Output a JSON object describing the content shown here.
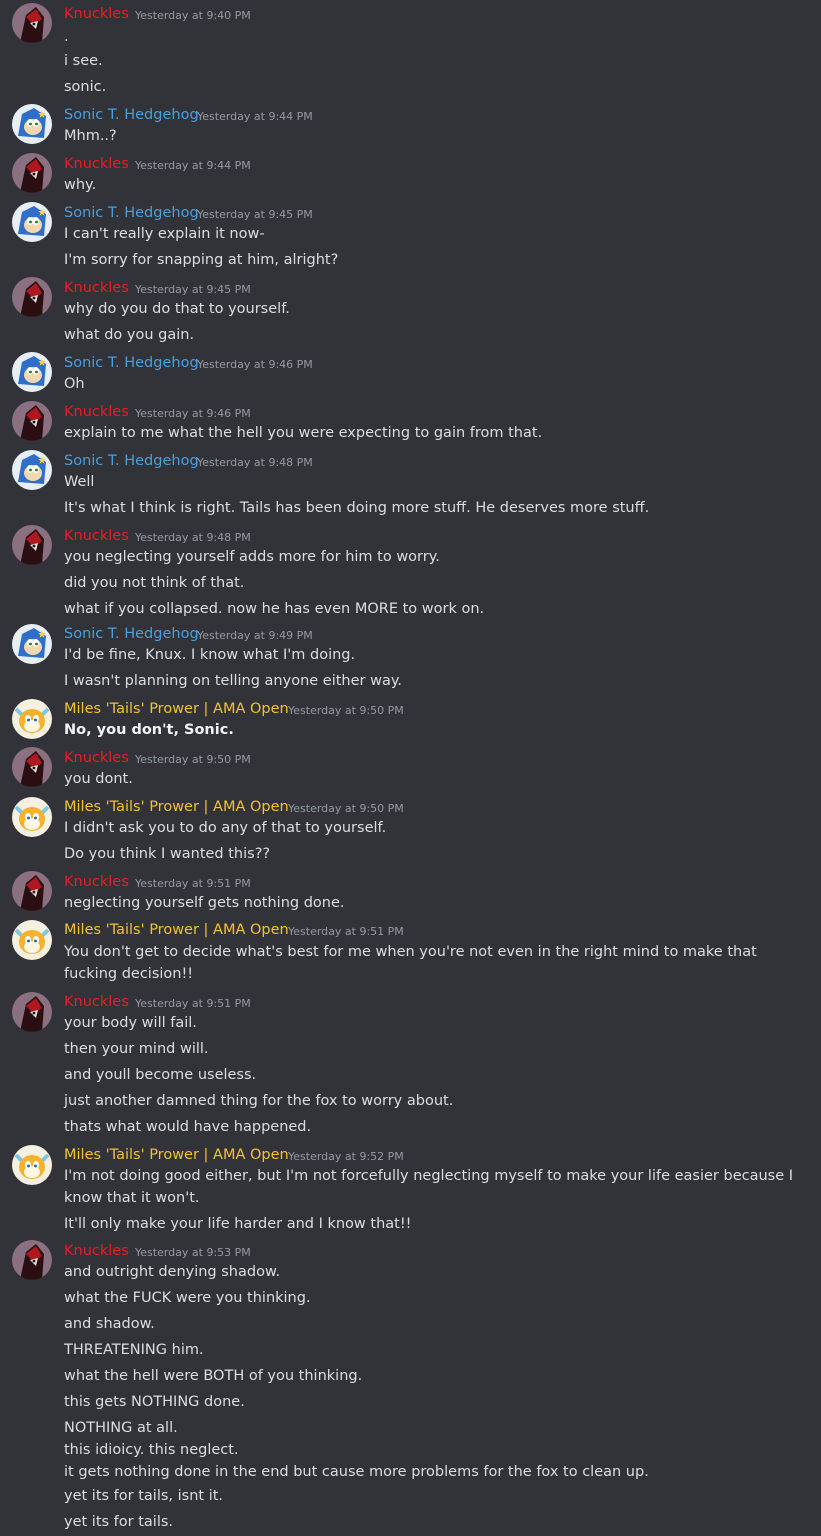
{
  "users": {
    "knuckles": {
      "name": "Knuckles",
      "color": "#ed1c24"
    },
    "sonic": {
      "name": "Sonic T. Hedgehog",
      "color": "#4a9fdf"
    },
    "tails": {
      "name": "Miles 'Tails' Prower | AMA Open",
      "color": "#f2c230"
    }
  },
  "messages": [
    {
      "user": "Knuckles",
      "time": "Yesterday at 9:40 PM",
      "lines": [
        ".",
        "i see.",
        "sonic."
      ]
    },
    {
      "user": "Sonic T. Hedgehog",
      "time": "Yesterday at 9:44 PM",
      "lines": [
        "Mhm..?"
      ]
    },
    {
      "user": "Knuckles",
      "time": "Yesterday at 9:44 PM",
      "lines": [
        "why."
      ]
    },
    {
      "user": "Sonic T. Hedgehog",
      "time": "Yesterday at 9:45 PM",
      "lines": [
        "I can't really explain it now-",
        "I'm sorry for snapping at him, alright?"
      ]
    },
    {
      "user": "Knuckles",
      "time": "Yesterday at 9:45 PM",
      "lines": [
        "why do you do that to yourself.",
        "what do you gain."
      ]
    },
    {
      "user": "Sonic T. Hedgehog",
      "time": "Yesterday at 9:46 PM",
      "lines": [
        "Oh"
      ]
    },
    {
      "user": "Knuckles",
      "time": "Yesterday at 9:46 PM",
      "lines": [
        "explain to me what the hell you were expecting to gain from that."
      ]
    },
    {
      "user": "Sonic T. Hedgehog",
      "time": "Yesterday at 9:48 PM",
      "lines": [
        "Well",
        "It's what I think is right. Tails has been doing more stuff. He deserves more stuff."
      ]
    },
    {
      "user": "Knuckles",
      "time": "Yesterday at 9:48 PM",
      "lines": [
        "you neglecting yourself adds more for him to worry.",
        "did you not think of that.",
        "what if you collapsed. now he has even MORE to work on."
      ]
    },
    {
      "user": "Sonic T. Hedgehog",
      "time": "Yesterday at 9:49 PM",
      "lines": [
        "I'd be fine, Knux. I know what I'm doing.",
        "I wasn't planning on telling anyone either way."
      ]
    },
    {
      "user": "Miles 'Tails' Prower | AMA Open",
      "time": "Yesterday at 9:50 PM",
      "lines": [
        "No, you don't, Sonic."
      ]
    },
    {
      "user": "Knuckles",
      "time": "Yesterday at 9:50 PM",
      "lines": [
        "you dont."
      ]
    },
    {
      "user": "Miles 'Tails' Prower | AMA Open",
      "time": "Yesterday at 9:50 PM",
      "lines": [
        "I didn't ask you to do any of that to yourself.",
        "Do you think I wanted this??"
      ]
    },
    {
      "user": "Knuckles",
      "time": "Yesterday at 9:51 PM",
      "lines": [
        "neglecting yourself gets nothing done."
      ]
    },
    {
      "user": "Miles 'Tails' Prower | AMA Open",
      "time": "Yesterday at 9:51 PM",
      "lines": [
        "You don't get to decide what's best for me when you're not even in the right mind to make that fucking decision!!"
      ]
    },
    {
      "user": "Knuckles",
      "time": "Yesterday at 9:51 PM",
      "lines": [
        "your body will fail.",
        "then your mind will.",
        "and youll become useless.",
        "just another damned thing for the fox to worry about.",
        "thats what would have happened."
      ]
    },
    {
      "user": "Miles 'Tails' Prower | AMA Open",
      "time": "Yesterday at 9:52 PM",
      "lines": [
        "I'm not doing good either, but I'm not forcefully neglecting myself to make your life easier because I know that it won't.",
        "It'll only make your life harder and I know that!!"
      ]
    },
    {
      "user": "Knuckles",
      "time": "Yesterday at 9:53 PM",
      "lines": [
        "and outright denying shadow.",
        "what the FUCK were you thinking.",
        "and shadow.",
        "THREATENING him.",
        "what the hell were BOTH of you thinking.",
        "this gets NOTHING done.",
        "NOTHING at all.",
        "this idioicy. this neglect.",
        "it gets nothing done in the end but cause more problems for the fox to clean up.",
        "yet its for tails, isnt it.",
        "yet its for tails."
      ]
    }
  ]
}
